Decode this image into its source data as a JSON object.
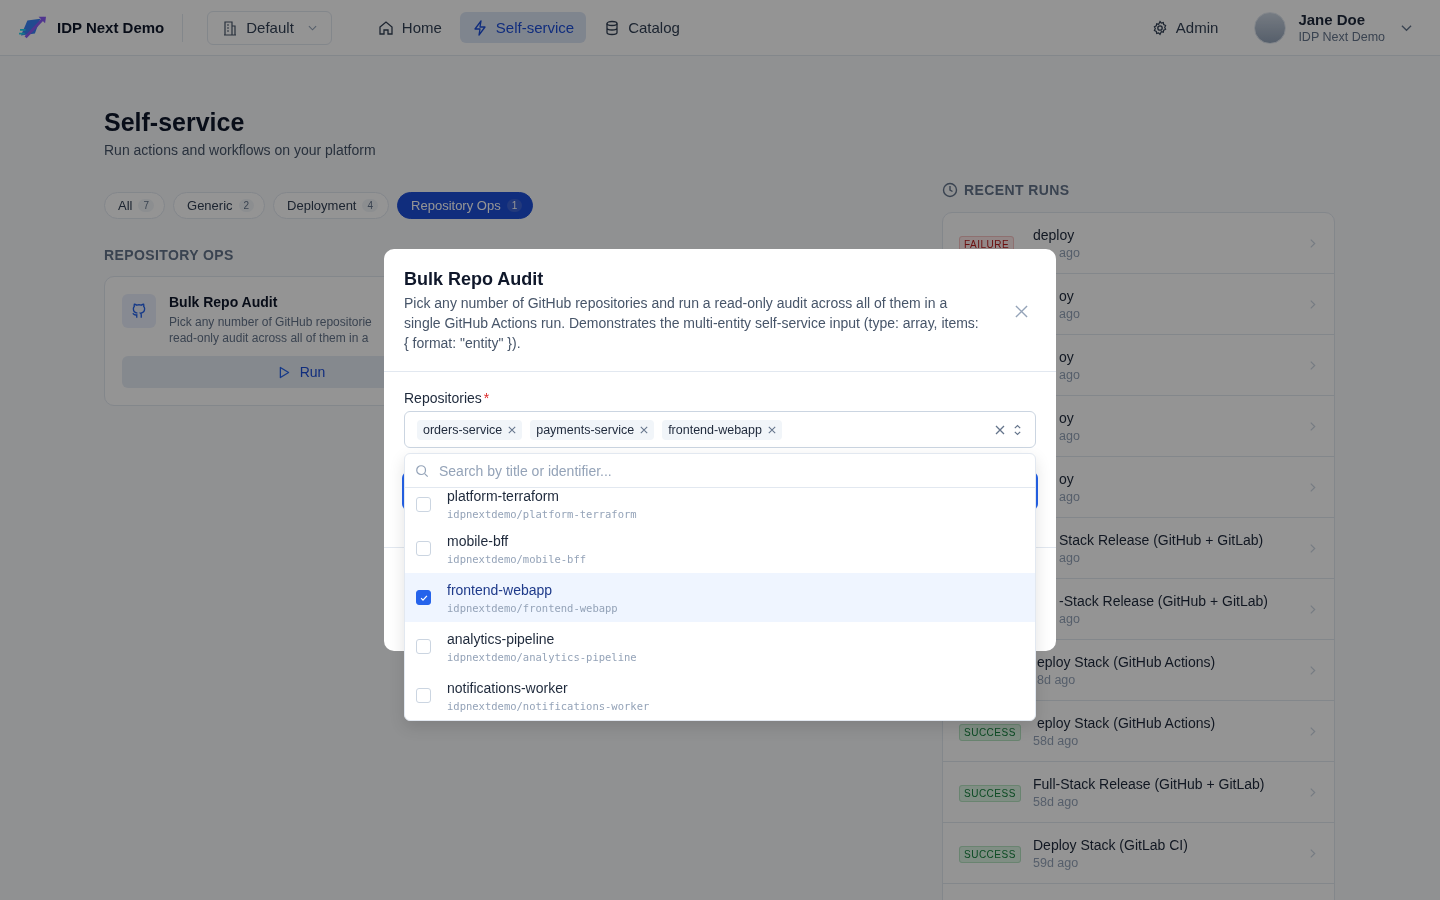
{
  "header": {
    "brand": "IDP Next Demo",
    "workspace": "Default",
    "nav": [
      {
        "label": "Home",
        "selected": false
      },
      {
        "label": "Self-service",
        "selected": true
      },
      {
        "label": "Catalog",
        "selected": false
      }
    ],
    "admin": "Admin",
    "user": {
      "name": "Jane Doe",
      "org": "IDP Next Demo"
    }
  },
  "page": {
    "title": "Self-service",
    "subtitle": "Run actions and workflows on your platform"
  },
  "filters": [
    {
      "label": "All",
      "count": "7",
      "selected": false
    },
    {
      "label": "Generic",
      "count": "2",
      "selected": false
    },
    {
      "label": "Deployment",
      "count": "4",
      "selected": false
    },
    {
      "label": "Repository Ops",
      "count": "1",
      "selected": true
    }
  ],
  "section": {
    "title": "REPOSITORY OPS",
    "card": {
      "title": "Bulk Repo Audit",
      "description_lines": [
        "Pick any number of GitHub repositorie",
        "read-only audit across all of them in a"
      ],
      "button": "Run"
    }
  },
  "recent_runs": {
    "title": "RECENT RUNS",
    "rows": [
      {
        "kind": "modal-top",
        "badge": {
          "text": "FAILURE",
          "kind": "failure"
        },
        "name": "deploy",
        "time": "ago"
      },
      {
        "kind": "modal",
        "name": "oy",
        "time": "ago"
      },
      {
        "kind": "modal",
        "name": "oy",
        "time": "ago"
      },
      {
        "kind": "modal",
        "name": "oy",
        "time": "ago"
      },
      {
        "kind": "modal",
        "name": "oy",
        "time": "ago"
      },
      {
        "kind": "modal",
        "name": "Stack Release (GitHub + GitLab)",
        "time": "ago"
      },
      {
        "kind": "modal",
        "name": "-Stack Release (GitHub + GitLab)",
        "time": "ago"
      },
      {
        "kind": "list",
        "name": "eploy Stack (GitHub Actions)",
        "time": "8d ago"
      },
      {
        "kind": "list-bottom",
        "badge": {
          "text": "SUCCESS",
          "kind": "success"
        },
        "name": "eploy Stack (GitHub Actions)",
        "time": "58d ago"
      },
      {
        "kind": "full",
        "badge": {
          "text": "SUCCESS",
          "kind": "success"
        },
        "name": "Full-Stack Release (GitHub + GitLab)",
        "time": "58d ago"
      },
      {
        "kind": "full",
        "badge": {
          "text": "SUCCESS",
          "kind": "success"
        },
        "name": "Deploy Stack (GitLab CI)",
        "time": "59d ago"
      }
    ]
  },
  "modal": {
    "title": "Bulk Repo Audit",
    "description": "Pick any number of GitHub repositories and run a read-only audit across all of them in a single GitHub Actions run. Demonstrates the multi-entity self-service input (type: array, items: { format: \"entity\" }).",
    "field": {
      "label": "Repositories",
      "required_mark": "*",
      "chips": [
        "orders-service",
        "payments-service",
        "frontend-webapp"
      ]
    },
    "dropdown": {
      "placeholder": "Search by title or identifier...",
      "options": [
        {
          "name": "platform-terraform",
          "path": "idpnextdemo/platform-terraform",
          "checked": false,
          "selected": false
        },
        {
          "name": "mobile-bff",
          "path": "idpnextdemo/mobile-bff",
          "checked": false,
          "selected": false
        },
        {
          "name": "frontend-webapp",
          "path": "idpnextdemo/frontend-webapp",
          "checked": true,
          "selected": true
        },
        {
          "name": "analytics-pipeline",
          "path": "idpnextdemo/analytics-pipeline",
          "checked": false,
          "selected": false
        },
        {
          "name": "notifications-worker",
          "path": "idpnextdemo/notifications-worker",
          "checked": false,
          "selected": false
        }
      ]
    }
  }
}
